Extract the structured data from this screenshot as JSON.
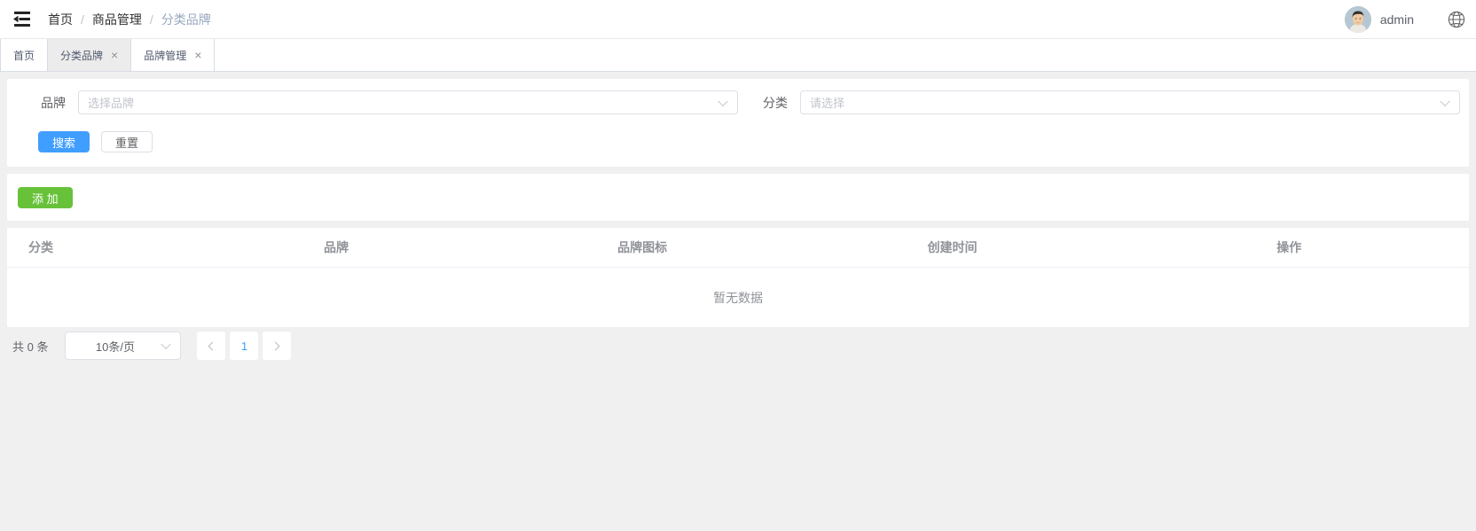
{
  "navbar": {
    "breadcrumb": {
      "separator": "/",
      "items": [
        "首页",
        "商品管理",
        "分类品牌"
      ]
    },
    "user": {
      "name": "admin"
    }
  },
  "tabs": [
    {
      "label": "首页",
      "closable": false,
      "active": false
    },
    {
      "label": "分类品牌",
      "closable": true,
      "active": true
    },
    {
      "label": "品牌管理",
      "closable": true,
      "active": false
    }
  ],
  "icons": {
    "collapse_menu": "menu-fold-icon",
    "language": "globe-icon",
    "tab_close": "×",
    "select_arrow": "chevron-down-icon"
  },
  "filter": {
    "brand": {
      "label": "品牌",
      "placeholder": "选择品牌"
    },
    "category": {
      "label": "分类",
      "placeholder": "请选择"
    },
    "search_label": "搜索",
    "reset_label": "重置"
  },
  "toolbar": {
    "add_label": "添 加"
  },
  "table": {
    "columns": [
      "分类",
      "品牌",
      "品牌图标",
      "创建时间",
      "操作"
    ],
    "rows": [],
    "empty_text": "暂无数据"
  },
  "pagination": {
    "total_text": "共 0 条",
    "page_size": "10条/页",
    "current_page": "1"
  },
  "colors": {
    "primary": "#409eff",
    "success": "#67c23a",
    "breadcrumb_current": "#97a8be",
    "page_bg": "#f0f0f0",
    "table_header_text": "#909399"
  }
}
